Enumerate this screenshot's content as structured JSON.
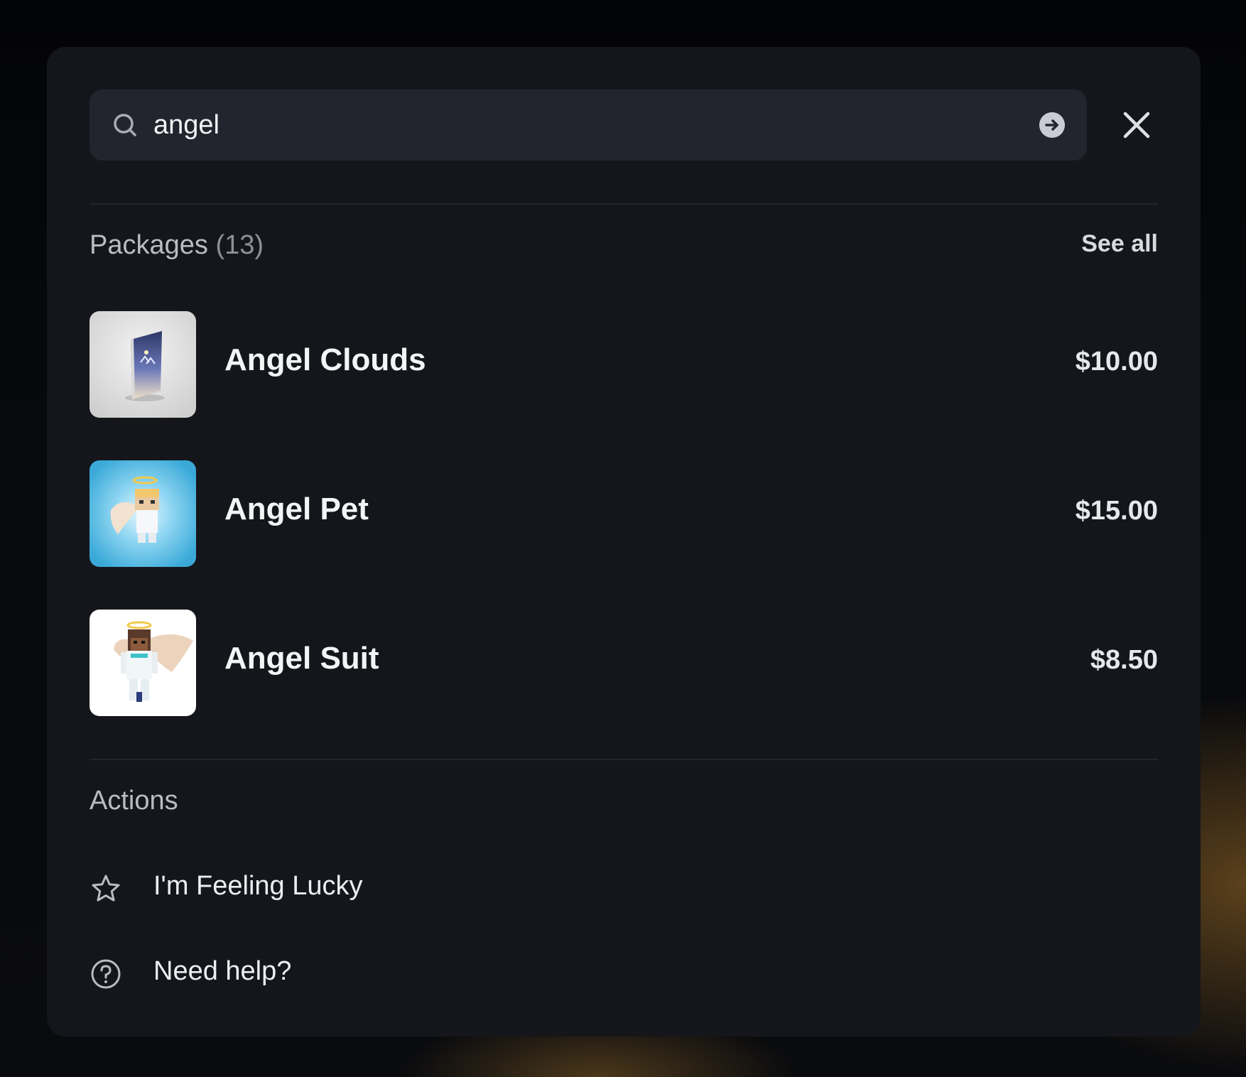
{
  "search": {
    "value": "angel",
    "go_icon": "arrow-right-circle-icon",
    "close_icon": "close-icon"
  },
  "packages": {
    "title": "Packages",
    "count": "(13)",
    "see_all_label": "See all",
    "items": [
      {
        "name": "Angel Clouds",
        "price": "$10.00"
      },
      {
        "name": "Angel Pet",
        "price": "$15.00"
      },
      {
        "name": "Angel Suit",
        "price": "$8.50"
      }
    ]
  },
  "actions": {
    "title": "Actions",
    "items": [
      {
        "label": "I'm Feeling Lucky",
        "icon": "star-icon"
      },
      {
        "label": "Need help?",
        "icon": "question-circle-icon"
      }
    ]
  },
  "colors": {
    "modal_bg": "#14161b",
    "search_bg": "#22242e",
    "text_primary": "#f3f4f6",
    "text_muted": "#b9bcc4"
  }
}
